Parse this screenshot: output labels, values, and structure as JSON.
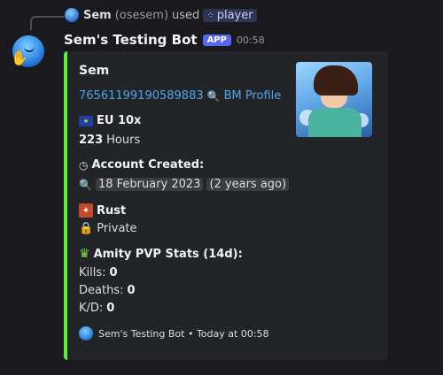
{
  "reply": {
    "user_name": "Sem",
    "user_handle": "(osesem)",
    "used_text": "used",
    "command": "player"
  },
  "message": {
    "bot_name": "Sem's Testing Bot",
    "app_tag": "APP",
    "time": "00:58"
  },
  "embed": {
    "accent_color": "#57f234",
    "title": "Sem",
    "steam_id": "76561199190589883",
    "bm_profile": "BM Profile",
    "server": "EU 10x",
    "hours_value": "223",
    "hours_label": "Hours",
    "account_created_label": "Account Created:",
    "account_created_date": "18 February 2023",
    "account_created_relative": "(2 years ago)",
    "game": "Rust",
    "privacy": "Private",
    "stats_title": "Amity PVP Stats (14d):",
    "kills_label": "Kills:",
    "kills_value": "0",
    "deaths_label": "Deaths:",
    "deaths_value": "0",
    "kd_label": "K/D:",
    "kd_value": "0",
    "footer_text": "Sem's Testing Bot • Today at 00:58"
  },
  "icons": {
    "command": "command-icon",
    "flag": "eu-flag-icon",
    "clock": "clock-icon",
    "search": "magnifier-icon",
    "rust": "rust-icon",
    "lock": "lock-icon",
    "crown": "crown-icon"
  }
}
